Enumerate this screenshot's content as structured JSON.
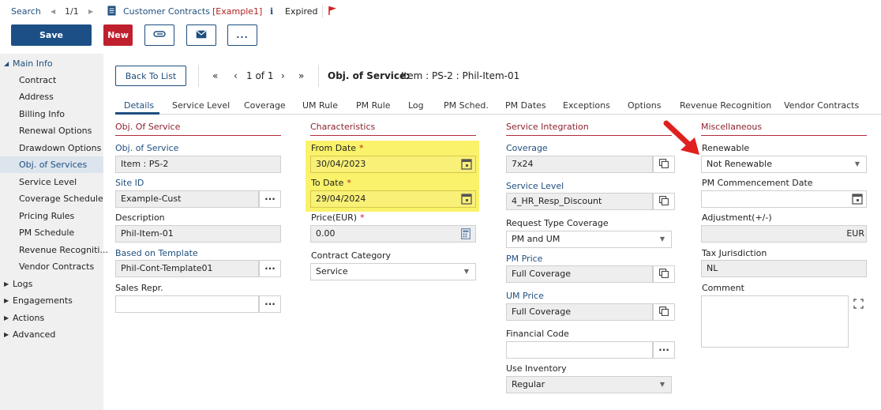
{
  "topbar": {
    "search_label": "Search",
    "record_counter": "1/1",
    "title": "Customer Contracts",
    "title_tag": "[Example1]",
    "status": "Expired"
  },
  "toolbar": {
    "save_label": "Save",
    "new_label": "New",
    "more_label": "..."
  },
  "sidebar": {
    "main_info": "Main Info",
    "items": [
      "Contract",
      "Address",
      "Billing Info",
      "Renewal Options",
      "Drawdown Options",
      "Obj. of Services",
      "Service Level",
      "Coverage Schedule",
      "Pricing Rules",
      "PM Schedule",
      "Revenue Recogniti...",
      "Vendor Contracts"
    ],
    "active_item": "Obj. of Services",
    "groups": [
      "Logs",
      "Engagements",
      "Actions",
      "Advanced"
    ]
  },
  "recordnav": {
    "back_label": "Back To List",
    "pager": "1 of 1",
    "heading_label": "Obj. of Service:",
    "heading_value": "Item : PS-2 : Phil-Item-01"
  },
  "tabs": [
    "Details",
    "Service Level",
    "Coverage",
    "UM Rule",
    "PM Rule",
    "Log",
    "PM Sched.",
    "PM Dates",
    "Exceptions",
    "Options",
    "Revenue Recognition",
    "Vendor Contracts"
  ],
  "active_tab": "Details",
  "obj_of_service": {
    "header": "Obj. Of Service",
    "obj_label": "Obj. of Service",
    "obj_value": "Item : PS-2",
    "site_label": "Site ID",
    "site_value": "Example-Cust",
    "desc_label": "Description",
    "desc_value": "Phil-Item-01",
    "template_label": "Based on Template",
    "template_value": "Phil-Cont-Template01",
    "sales_label": "Sales Repr.",
    "sales_value": ""
  },
  "characteristics": {
    "header": "Characteristics",
    "from_label": "From Date",
    "from_value": "30/04/2023",
    "to_label": "To Date",
    "to_value": "29/04/2024",
    "price_label": "Price(EUR)",
    "price_value": "0.00",
    "category_label": "Contract Category",
    "category_value": "Service",
    "required_mark": "*"
  },
  "service_integration": {
    "header": "Service Integration",
    "coverage_label": "Coverage",
    "coverage_value": "7x24",
    "service_level_label": "Service Level",
    "service_level_value": "4_HR_Resp_Discount",
    "request_label": "Request Type Coverage",
    "request_value": "PM and UM",
    "pm_price_label": "PM Price",
    "pm_price_value": "Full Coverage",
    "um_price_label": "UM Price",
    "um_price_value": "Full Coverage",
    "fin_code_label": "Financial Code",
    "fin_code_value": "",
    "inventory_label": "Use Inventory",
    "inventory_value": "Regular"
  },
  "misc": {
    "header": "Miscellaneous",
    "renewable_label": "Renewable",
    "renewable_value": "Not Renewable",
    "pm_commence_label": "PM Commencement Date",
    "pm_commence_value": "",
    "adjustment_label": "Adjustment(+/-)",
    "adjustment_unit": "EUR",
    "tax_label": "Tax Jurisdiction",
    "tax_value": "NL",
    "comment_label": "Comment",
    "comment_value": ""
  },
  "colors": {
    "accent": "#1c4f86",
    "danger": "#c0202e",
    "section": "#8e2230",
    "highlight": "#faf26a",
    "annotation_arrow": "#e0201e"
  }
}
